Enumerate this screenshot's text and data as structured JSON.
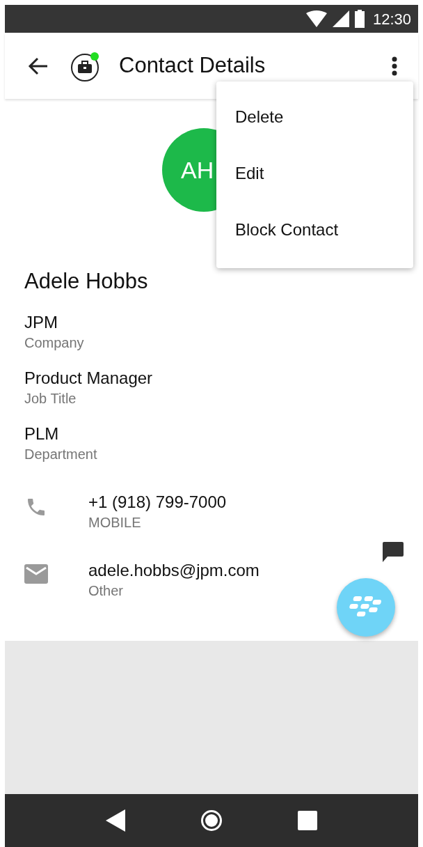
{
  "status_bar": {
    "time": "12:30"
  },
  "toolbar": {
    "title": "Contact Details"
  },
  "contact": {
    "initials": "AH",
    "name": "Adele Hobbs"
  },
  "fields": [
    {
      "value": "JPM",
      "label": "Company"
    },
    {
      "value": "Product Manager",
      "label": "Job Title"
    },
    {
      "value": "PLM",
      "label": "Department"
    }
  ],
  "methods": [
    {
      "kind": "phone",
      "value": "+1 (918) 799-7000",
      "label": "MOBILE"
    },
    {
      "kind": "email",
      "value": "adele.hobbs@jpm.com",
      "label": "Other"
    }
  ],
  "menu": {
    "items": [
      "Delete",
      "Edit",
      "Block Contact"
    ]
  }
}
